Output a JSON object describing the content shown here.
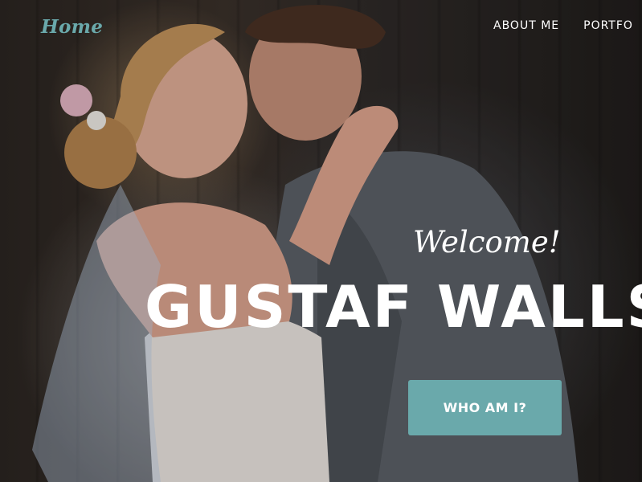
{
  "nav": {
    "home_label": "Home",
    "links": [
      "ABOUT ME",
      "PORTFO"
    ]
  },
  "hero": {
    "welcome": "Welcome!",
    "headline": "GUSTAF WALLST",
    "cta_label": "WHO AM I?"
  },
  "colors": {
    "accent": "#6aa9ab",
    "text": "#ffffff"
  }
}
